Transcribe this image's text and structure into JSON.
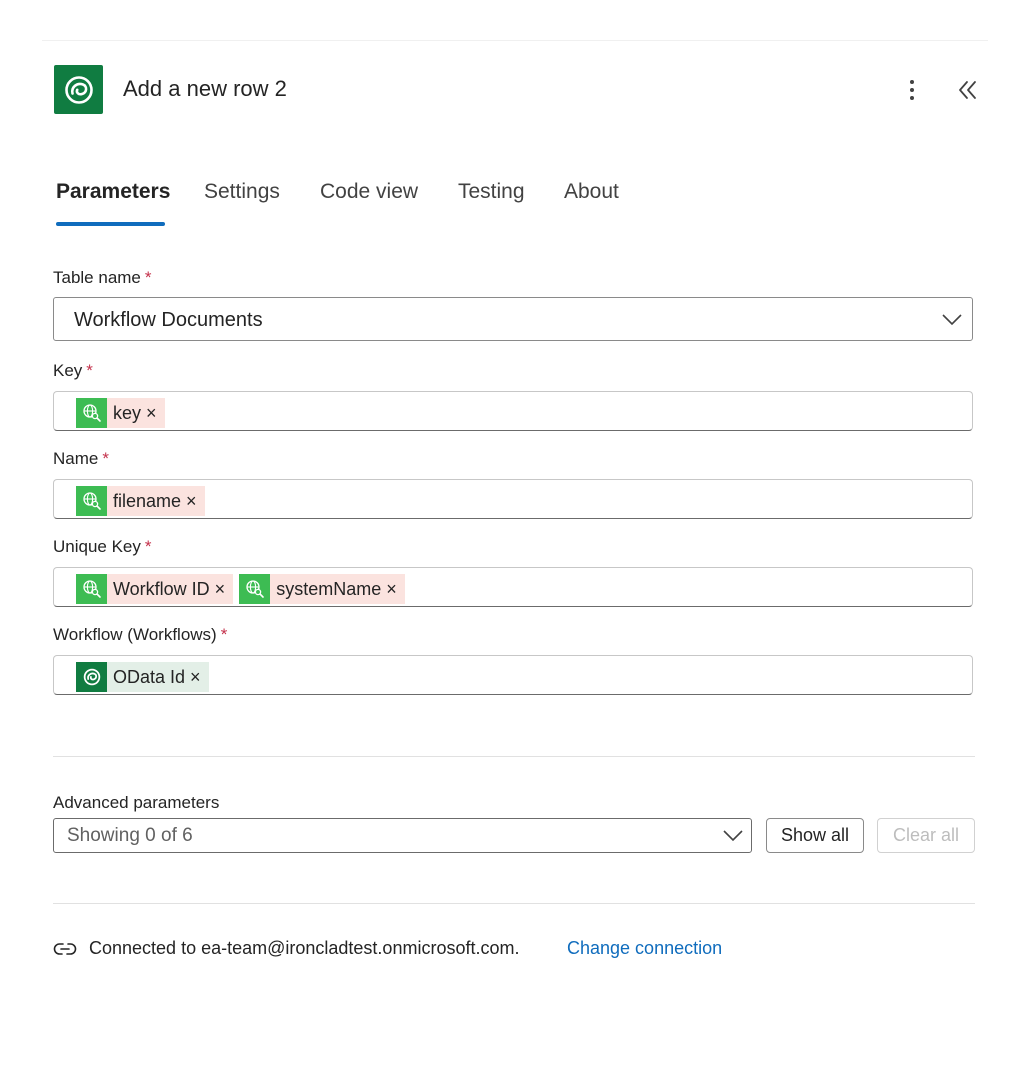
{
  "header": {
    "title": "Add a new row 2",
    "app_icon": "dataverse-icon",
    "more_icon": "more-vertical-icon",
    "collapse_icon": "double-chevron-left-icon"
  },
  "tabs": [
    {
      "label": "Parameters",
      "active": true
    },
    {
      "label": "Settings",
      "active": false
    },
    {
      "label": "Code view",
      "active": false
    },
    {
      "label": "Testing",
      "active": false
    },
    {
      "label": "About",
      "active": false
    }
  ],
  "form": {
    "required_marker": "*",
    "table_name": {
      "label": "Table name",
      "value": "Workflow Documents"
    },
    "key": {
      "label": "Key",
      "tokens": [
        {
          "label": "key ×",
          "icon": "web-search-icon"
        }
      ]
    },
    "name": {
      "label": "Name",
      "tokens": [
        {
          "label": "filename ×",
          "icon": "web-search-icon"
        }
      ]
    },
    "unique_key": {
      "label": "Unique Key",
      "tokens": [
        {
          "label": "Workflow ID ×",
          "icon": "web-search-icon"
        },
        {
          "label": "systemName ×",
          "icon": "web-search-icon"
        }
      ]
    },
    "workflow": {
      "label": "Workflow (Workflows)",
      "tokens": [
        {
          "label": "OData Id ×",
          "icon": "dataverse-icon"
        }
      ]
    }
  },
  "advanced": {
    "label": "Advanced parameters",
    "value": "Showing 0 of 6",
    "show_all": "Show all",
    "clear_all": "Clear all"
  },
  "connection": {
    "text": "Connected to ea-team@ironcladtest.onmicrosoft.com.",
    "link": "Change connection",
    "icon": "link-icon"
  },
  "colors": {
    "accent": "#0f6cbd",
    "dataverse_green": "#107c41",
    "web_token_green": "#3dbc53",
    "web_token_bg": "#fbe3df",
    "dataverse_token_bg": "#e3efe7",
    "required_red": "#c4314b"
  }
}
